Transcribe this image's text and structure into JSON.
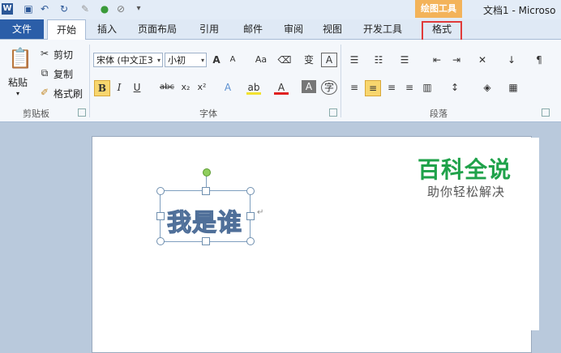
{
  "titlebar": {
    "drawing_tools": "绘图工具",
    "doc_title": "文档1 - Microso"
  },
  "tabs": [
    {
      "label": "文件"
    },
    {
      "label": "开始"
    },
    {
      "label": "插入"
    },
    {
      "label": "页面布局"
    },
    {
      "label": "引用"
    },
    {
      "label": "邮件"
    },
    {
      "label": "审阅"
    },
    {
      "label": "视图"
    },
    {
      "label": "开发工具"
    },
    {
      "label": "格式"
    }
  ],
  "clipboard": {
    "paste": "粘贴",
    "cut": "剪切",
    "copy": "复制",
    "format_painter": "格式刷",
    "group_label": "剪贴板"
  },
  "font": {
    "font_name": "宋体 (中文正3",
    "font_size": "小初",
    "grow": "A",
    "shrink": "A",
    "change_case": "Aa",
    "bold": "B",
    "italic": "I",
    "underline": "U",
    "strikethrough": "abc",
    "subscript": "x₂",
    "superscript": "x²",
    "group_label": "字体"
  },
  "paragraph": {
    "group_label": "段落"
  },
  "document": {
    "wordart_text": "我是谁",
    "para_mark": "↵"
  },
  "watermark": {
    "title": "百科全说",
    "subtitle": "助你轻松解决"
  }
}
